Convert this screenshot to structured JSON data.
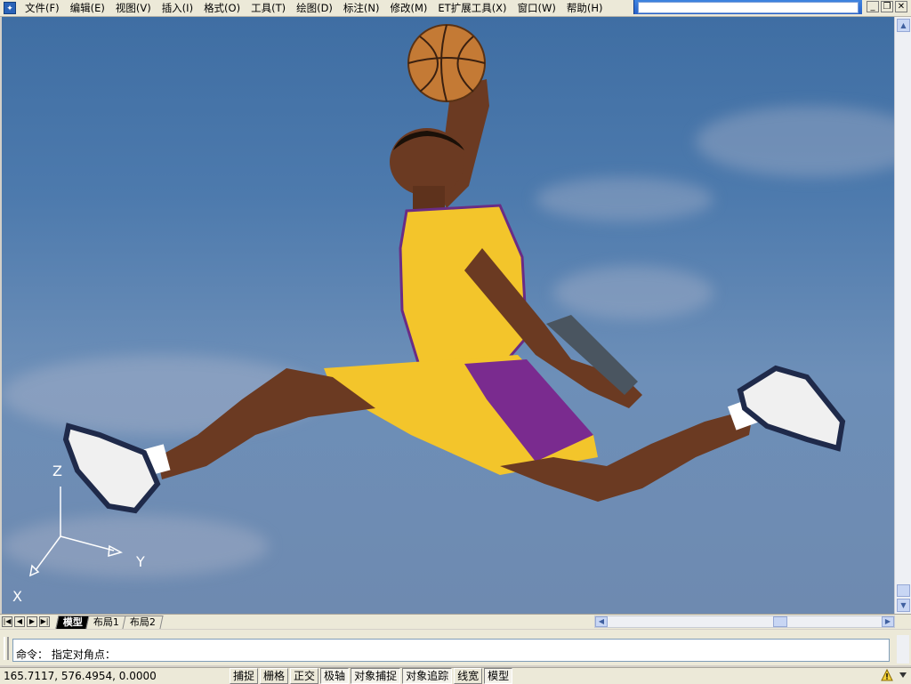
{
  "menu": {
    "items": [
      "文件(F)",
      "编辑(E)",
      "视图(V)",
      "插入(I)",
      "格式(O)",
      "工具(T)",
      "绘图(D)",
      "标注(N)",
      "修改(M)",
      "ET扩展工具(X)",
      "窗口(W)",
      "帮助(H)"
    ]
  },
  "window_controls": {
    "minimize": "_",
    "restore": "❐",
    "close": "✕"
  },
  "ucs": {
    "z": "Z",
    "y": "Y",
    "x": "X"
  },
  "layout_tabs": [
    "模型",
    "布局1",
    "布局2"
  ],
  "active_tab": "模型",
  "command": {
    "prompt": "命令：",
    "text": "指定对角点："
  },
  "status": {
    "coordinates": "165.7117, 576.4954, 0.0000",
    "toggles": [
      {
        "label": "捕捉",
        "on": false
      },
      {
        "label": "栅格",
        "on": false
      },
      {
        "label": "正交",
        "on": false
      },
      {
        "label": "极轴",
        "on": true
      },
      {
        "label": "对象捕捉",
        "on": true
      },
      {
        "label": "对象追踪",
        "on": true
      },
      {
        "label": "线宽",
        "on": false
      },
      {
        "label": "模型",
        "on": true
      }
    ]
  },
  "colors": {
    "sky_top": "#3f6ea3",
    "jersey": "#f3c52b",
    "purple": "#7a2b8f",
    "skin": "#6b3a22"
  }
}
